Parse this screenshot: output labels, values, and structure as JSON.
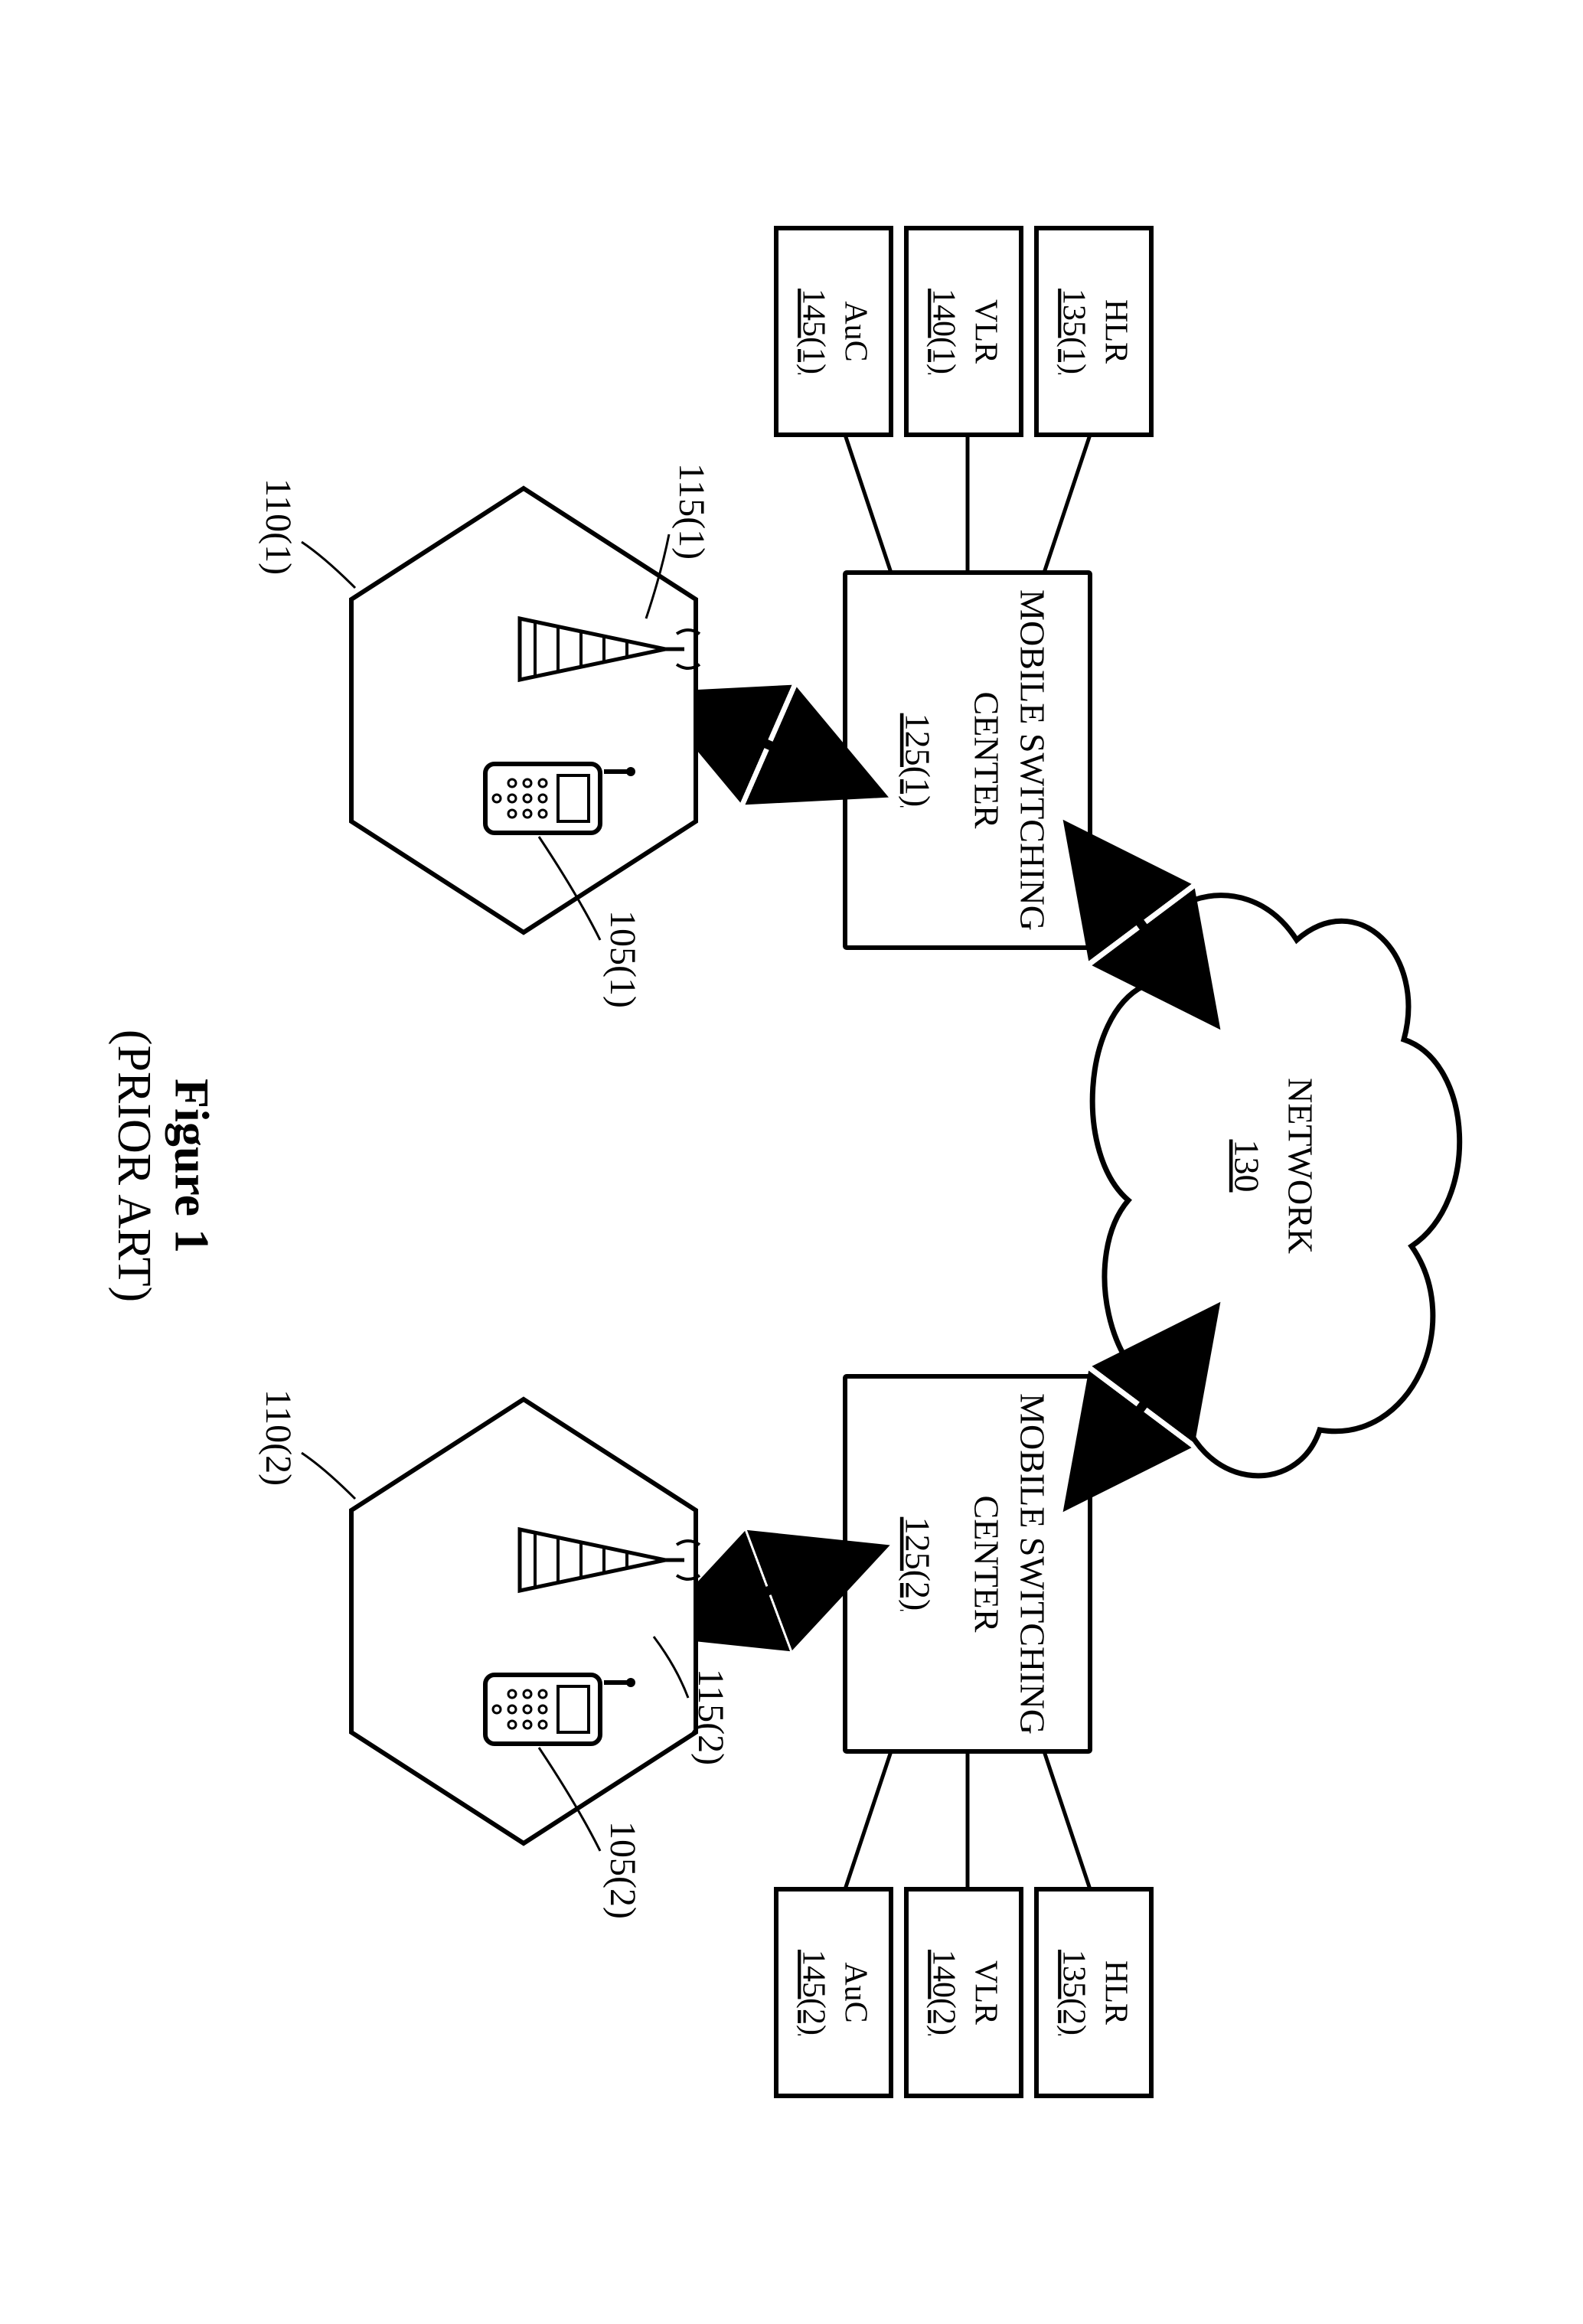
{
  "network": {
    "label": "NETWORK",
    "ref": "130"
  },
  "msc": {
    "1": {
      "line1": "MOBILE SWITCHING",
      "line2": "CENTER",
      "ref": "125(1)"
    },
    "2": {
      "line1": "MOBILE SWITCHING",
      "line2": "CENTER",
      "ref": "125(2)"
    }
  },
  "hlr": {
    "1": {
      "label": "HLR",
      "ref": "135(1)"
    },
    "2": {
      "label": "HLR",
      "ref": "135(2)"
    }
  },
  "vlr": {
    "1": {
      "label": "VLR",
      "ref": "140(1)"
    },
    "2": {
      "label": "VLR",
      "ref": "140(2)"
    }
  },
  "auc": {
    "1": {
      "label": "AuC",
      "ref": "145(1)"
    },
    "2": {
      "label": "AuC",
      "ref": "145(2)"
    }
  },
  "tower": {
    "1": "115(1)",
    "2": "115(2)"
  },
  "phone": {
    "1": "105(1)",
    "2": "105(2)"
  },
  "cell": {
    "1": "110(1)",
    "2": "110(2)"
  },
  "figure": {
    "num": "Figure 1",
    "sub": "(PRIOR ART)"
  }
}
